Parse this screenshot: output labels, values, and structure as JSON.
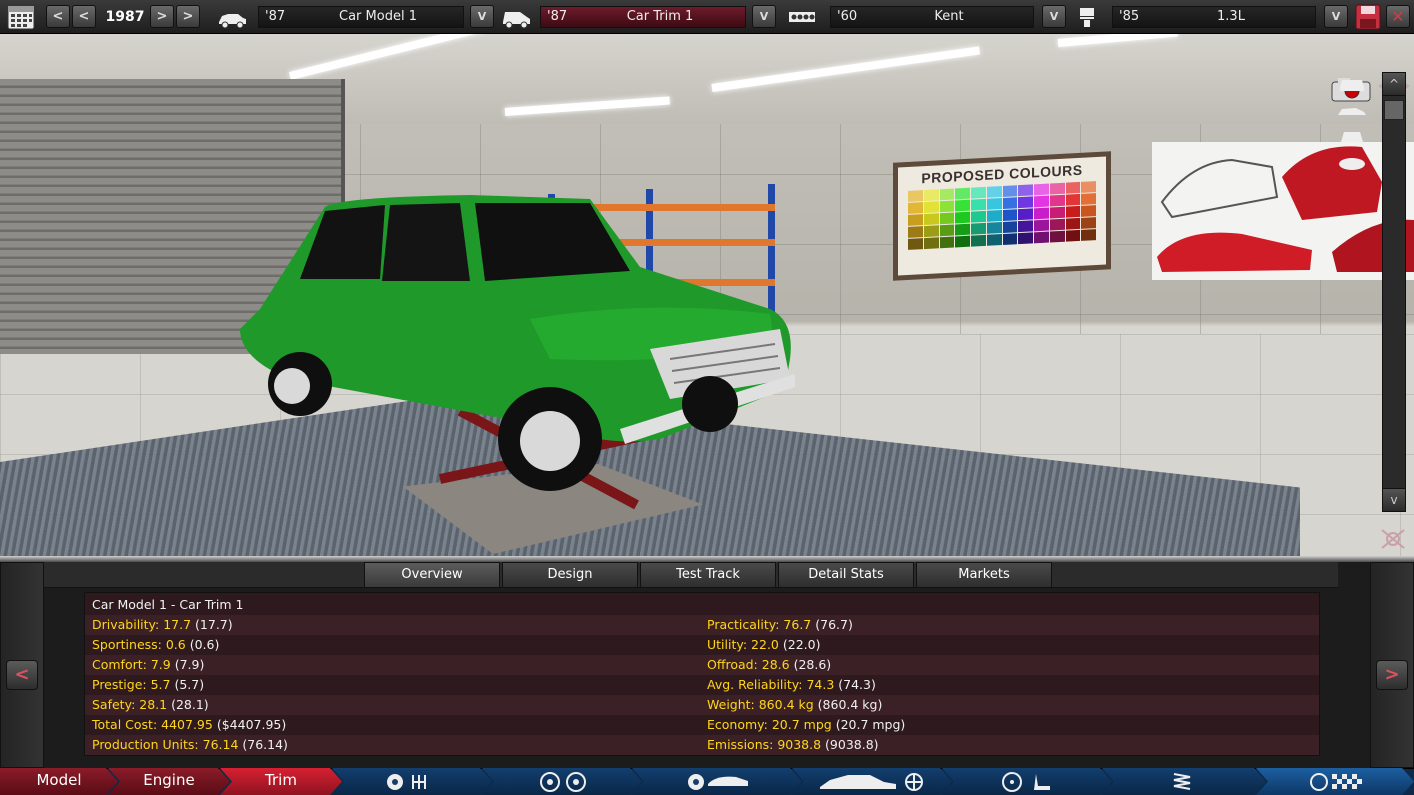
{
  "toolbar": {
    "year": "1987",
    "prev_fast_label": "<",
    "prev_label": "<",
    "next_label": ">",
    "next_fast_label": ">",
    "dropdown_label": "V",
    "model": {
      "year": "'87",
      "name": "Car Model 1"
    },
    "trim": {
      "year": "'87",
      "name": "Car Trim 1"
    },
    "engine_family": {
      "year": "'60",
      "name": "Kent"
    },
    "engine_variant": {
      "year": "'85",
      "name": "1.3L"
    },
    "close_label": "✕"
  },
  "viewport": {
    "poster_title": "PROPOSED COLOURS",
    "scroll_up_label": "^",
    "scroll_down_label": "v",
    "car_paint_color": "#1f9a2a"
  },
  "tabs": [
    {
      "label": "Overview",
      "active": true
    },
    {
      "label": "Design",
      "active": false
    },
    {
      "label": "Test Track",
      "active": false
    },
    {
      "label": "Detail Stats",
      "active": false
    },
    {
      "label": "Markets",
      "active": false
    }
  ],
  "panel": {
    "prev_label": "<",
    "next_label": ">",
    "title": "Car Model 1 - Car Trim 1",
    "left": [
      {
        "label": "Drivability: 17.7",
        "paren": "(17.7)"
      },
      {
        "label": "Sportiness: 0.6",
        "paren": "(0.6)"
      },
      {
        "label": "Comfort: 7.9",
        "paren": "(7.9)"
      },
      {
        "label": "Prestige: 5.7",
        "paren": "(5.7)"
      },
      {
        "label": "Safety: 28.1",
        "paren": "(28.1)"
      },
      {
        "label": "Total Cost: 4407.95",
        "paren": "($4407.95)"
      },
      {
        "label": "Production Units: 76.14",
        "paren": "(76.14)"
      }
    ],
    "right": [
      {
        "label": "Practicality: 76.7",
        "paren": "(76.7)"
      },
      {
        "label": "Utility: 22.0",
        "paren": "(22.0)"
      },
      {
        "label": "Offroad: 28.6",
        "paren": "(28.6)"
      },
      {
        "label": "Avg. Reliability: 74.3",
        "paren": "(74.3)"
      },
      {
        "label": "Weight: 860.4 kg",
        "paren": "(860.4 kg)"
      },
      {
        "label": "Economy: 20.7 mpg",
        "paren": "(20.7 mpg)"
      },
      {
        "label": "Emissions: 9038.8",
        "paren": "(9038.8)"
      }
    ]
  },
  "bottom_nav": {
    "model": "Model",
    "engine": "Engine",
    "trim": "Trim"
  },
  "colors": {
    "accent_red": "#d62032",
    "stat_yellow": "#ffd61a",
    "nav_blue": "#0d2a4a"
  }
}
